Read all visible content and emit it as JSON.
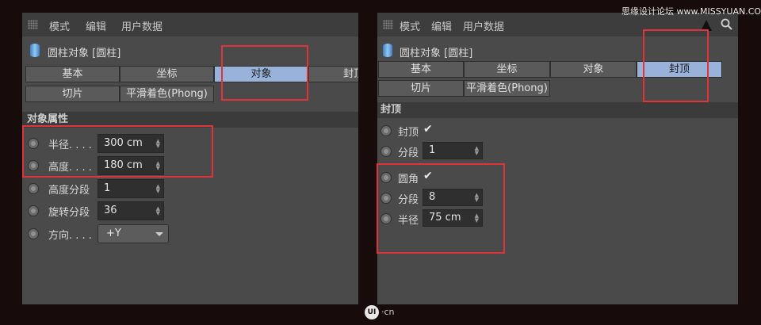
{
  "menu": {
    "items": [
      "模式",
      "编辑",
      "用户数据"
    ]
  },
  "left": {
    "object_title": "圆柱对象 [圆柱]",
    "tabs": [
      "基本",
      "坐标",
      "对象",
      "封顶"
    ],
    "tabs_row2": [
      "切片",
      "平滑着色(Phong)"
    ],
    "section": "对象属性",
    "props": [
      {
        "label": "半径. . . .",
        "value": "300 cm"
      },
      {
        "label": "高度. . . .",
        "value": "180 cm"
      },
      {
        "label": "高度分段",
        "value": "1"
      },
      {
        "label": "旋转分段",
        "value": "36"
      }
    ],
    "direction": {
      "label": "方向. . . .",
      "value": "+Y"
    }
  },
  "right": {
    "object_title": "圆柱对象 [圆柱]",
    "tabs": [
      "基本",
      "坐标",
      "对象",
      "封顶"
    ],
    "tabs_row2": [
      "切片",
      "平滑着色(Phong)"
    ],
    "section": "封顶",
    "caps": {
      "label": "封顶",
      "check": "✔"
    },
    "caps_seg": {
      "label": "分段",
      "value": "1"
    },
    "fillet": {
      "label": "圆角",
      "check": "✔"
    },
    "fillet_seg": {
      "label": "分段",
      "value": "8"
    },
    "fillet_radius": {
      "label": "半径",
      "value": "75 cm"
    }
  },
  "watermark": {
    "top": "思缘设计论坛 www.MISSYUAN.COM",
    "logo": "UI",
    "logo_suffix": "·cn"
  },
  "colors": {
    "highlight": "#e0343a",
    "active_tab": "#98b2d9",
    "background": "#170b0c"
  }
}
